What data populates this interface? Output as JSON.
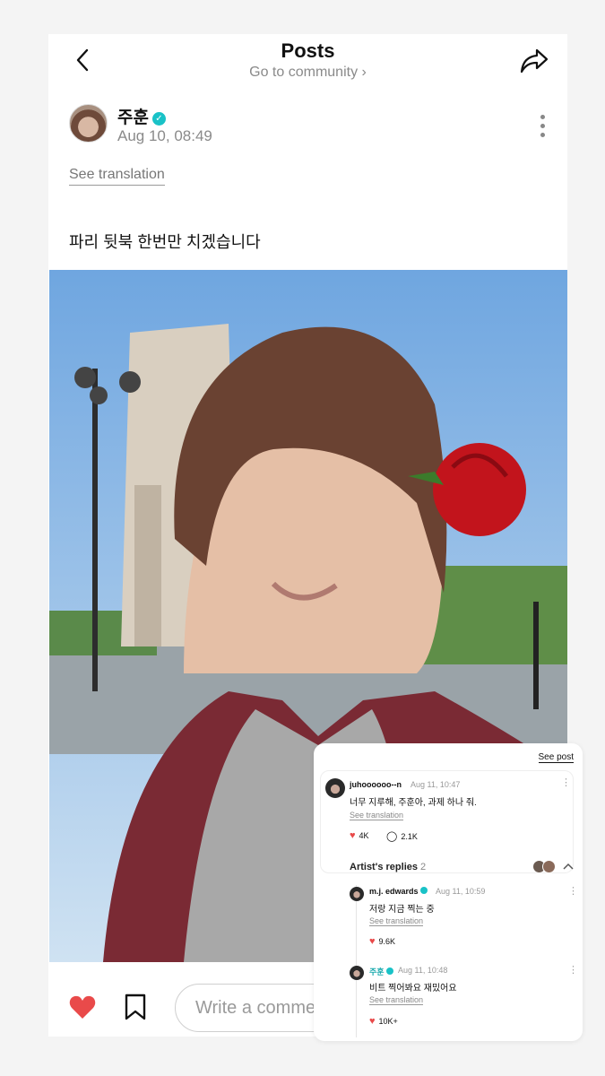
{
  "header": {
    "title": "Posts",
    "subtitle": "Go to community ›"
  },
  "author": {
    "name": "주훈",
    "time": "Aug 10, 08:49"
  },
  "post": {
    "see_translation": "See translation",
    "text": "파리 뒷북 한번만 치겠습니다"
  },
  "bottom_bar": {
    "comment_placeholder": "Write a comment"
  },
  "overlay": {
    "see_post": "See post",
    "comment": {
      "user": "juhoooooo--n",
      "time": "Aug 11, 10:47",
      "text": "너무 지루해, 주훈아, 과제 하나 줘.",
      "see_translation": "See translation",
      "likes": "4K",
      "replies": "2.1K"
    },
    "artist_replies": {
      "label": "Artist's replies",
      "count": "2"
    },
    "replies": [
      {
        "user": "m.j. edwards",
        "time": "Aug 11, 10:59",
        "text": "저랑 지금 찍는 중",
        "see_translation": "See translation",
        "likes": "9.6K"
      },
      {
        "user": "주훈",
        "time": "Aug 11, 10:48",
        "text": "비트 찍어봐요 재밌어요",
        "see_translation": "See translation",
        "likes": "10K+"
      }
    ]
  },
  "colors": {
    "accent_heart": "#e94a4a",
    "verified": "#19c2c7"
  },
  "icons": [
    "back-arrow-icon",
    "share-icon",
    "more-vertical-icon",
    "heart-icon",
    "bookmark-icon",
    "chevron-up-icon",
    "comment-bubble-icon",
    "verified-badge-icon"
  ]
}
